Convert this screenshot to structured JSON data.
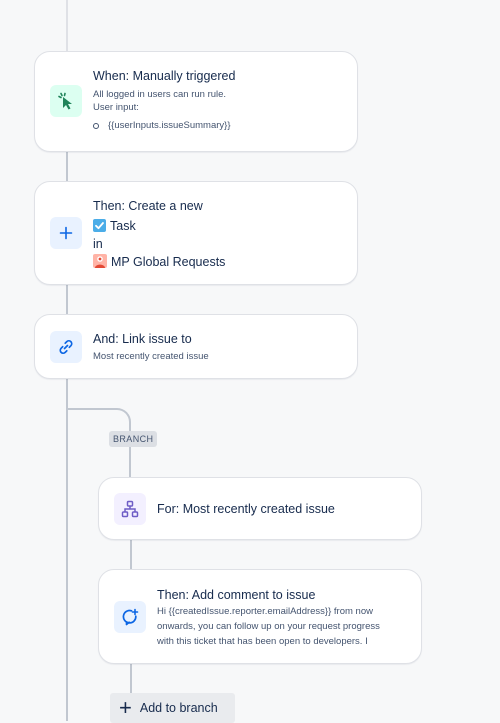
{
  "colors": {
    "background": "#f7f8f9",
    "connector": "#c1c7d0",
    "trigger_icon_bg": "#dcfff1",
    "trigger_icon": "#1f845a",
    "action_icon_bg": "#e9f2ff",
    "action_icon": "#0c66e4",
    "branch_icon_bg": "#f3f0ff",
    "branch_icon": "#6e5dc6"
  },
  "trigger": {
    "icon": "cursor-click-icon",
    "title": "When: Manually triggered",
    "line1": "All logged in users can run rule.",
    "line2": "User input:",
    "input_value": "{{userInputs.issueSummary}}"
  },
  "create_issue": {
    "icon": "plus-icon",
    "title": "Then: Create a new",
    "issue_type": "Task",
    "connector_word": "in",
    "project": "MP Global Requests"
  },
  "link_issue": {
    "icon": "link-icon",
    "title": "And: Link issue to",
    "subtitle": "Most recently created issue"
  },
  "branch": {
    "tag": "BRANCH",
    "for_card": {
      "icon": "branch-hierarchy-icon",
      "title": "For: Most recently created issue"
    },
    "comment_card": {
      "icon": "comment-add-icon",
      "title": "Then: Add comment to issue",
      "line1": "Hi {{createdIssue.reporter.emailAddress}} from now",
      "line2": "onwards, you can follow up on your request progress",
      "line3": "with this ticket that has been open to developers. I"
    },
    "add_button": "Add to branch"
  }
}
